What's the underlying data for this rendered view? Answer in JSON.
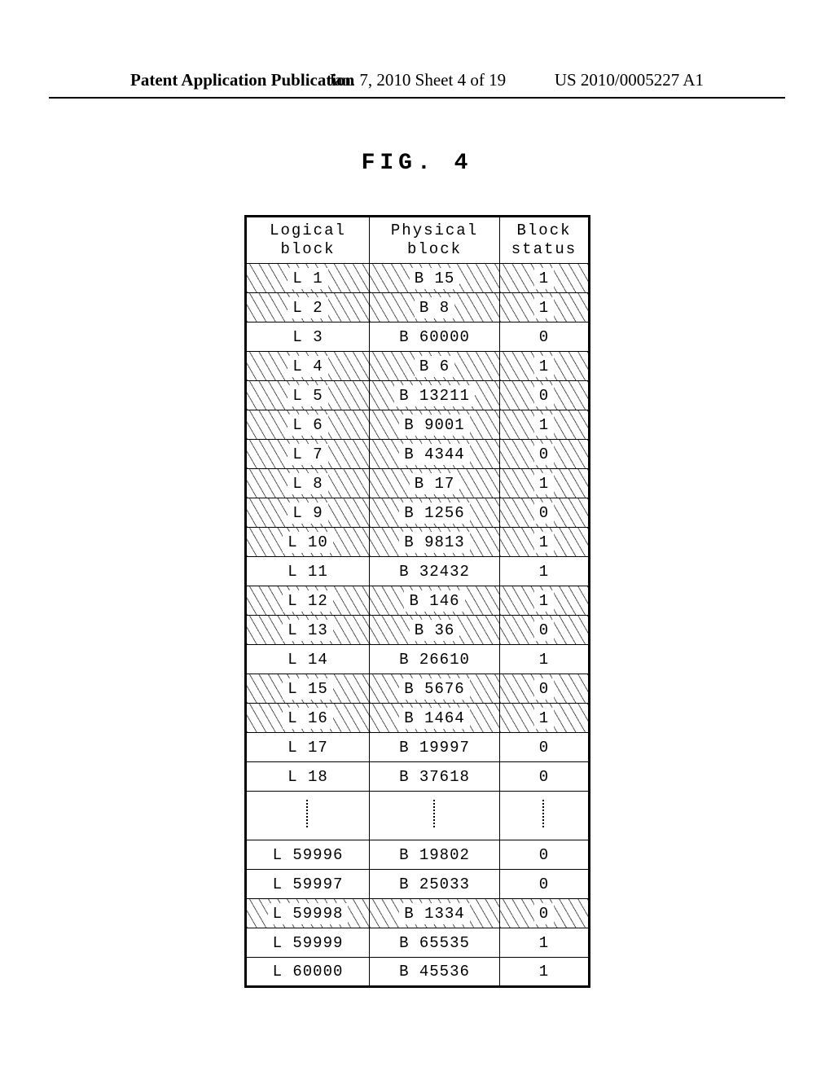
{
  "header": {
    "left": "Patent Application Publication",
    "center": "Jan. 7, 2010  Sheet 4 of 19",
    "right": "US 2010/0005227 A1"
  },
  "figure_label": "FIG. 4",
  "table": {
    "columns": {
      "logical": "Logical block",
      "physical": "Physical block",
      "status": "Block status"
    },
    "rows": [
      {
        "logical": "L 1",
        "physical": "B 15",
        "status": "1",
        "hatched": true
      },
      {
        "logical": "L 2",
        "physical": "B 8",
        "status": "1",
        "hatched": true
      },
      {
        "logical": "L 3",
        "physical": "B 60000",
        "status": "0",
        "hatched": false
      },
      {
        "logical": "L 4",
        "physical": "B 6",
        "status": "1",
        "hatched": true
      },
      {
        "logical": "L 5",
        "physical": "B 13211",
        "status": "0",
        "hatched": true
      },
      {
        "logical": "L 6",
        "physical": "B 9001",
        "status": "1",
        "hatched": true
      },
      {
        "logical": "L 7",
        "physical": "B 4344",
        "status": "0",
        "hatched": true
      },
      {
        "logical": "L 8",
        "physical": "B 17",
        "status": "1",
        "hatched": true
      },
      {
        "logical": "L 9",
        "physical": "B 1256",
        "status": "0",
        "hatched": true
      },
      {
        "logical": "L 10",
        "physical": "B 9813",
        "status": "1",
        "hatched": true
      },
      {
        "logical": "L 11",
        "physical": "B 32432",
        "status": "1",
        "hatched": false
      },
      {
        "logical": "L 12",
        "physical": "B 146",
        "status": "1",
        "hatched": true
      },
      {
        "logical": "L 13",
        "physical": "B 36",
        "status": "0",
        "hatched": true
      },
      {
        "logical": "L 14",
        "physical": "B 26610",
        "status": "1",
        "hatched": false
      },
      {
        "logical": "L 15",
        "physical": "B 5676",
        "status": "0",
        "hatched": true
      },
      {
        "logical": "L 16",
        "physical": "B 1464",
        "status": "1",
        "hatched": true
      },
      {
        "logical": "L 17",
        "physical": "B 19997",
        "status": "0",
        "hatched": false
      },
      {
        "logical": "L 18",
        "physical": "B 37618",
        "status": "0",
        "hatched": false
      },
      {
        "ellipsis": true
      },
      {
        "logical": "L 59996",
        "physical": "B 19802",
        "status": "0",
        "hatched": false
      },
      {
        "logical": "L 59997",
        "physical": "B 25033",
        "status": "0",
        "hatched": false
      },
      {
        "logical": "L 59998",
        "physical": "B 1334",
        "status": "0",
        "hatched": true
      },
      {
        "logical": "L 59999",
        "physical": "B 65535",
        "status": "1",
        "hatched": false
      },
      {
        "logical": "L 60000",
        "physical": "B 45536",
        "status": "1",
        "hatched": false
      }
    ]
  }
}
